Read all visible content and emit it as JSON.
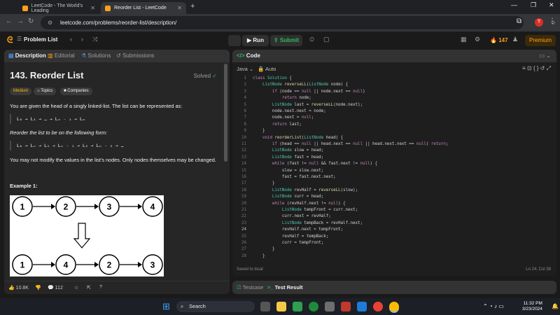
{
  "browser": {
    "tabs": [
      {
        "title": "LeetCode - The World's Leading"
      },
      {
        "title": "Reorder List - LeetCode"
      }
    ],
    "new_tab": "+",
    "url": "leetcode.com/problems/reorder-list/description/",
    "profile_initial": "T"
  },
  "topbar": {
    "problem_list": "Problem List",
    "run": "Run",
    "submit": "Submit",
    "streak": "147",
    "premium": "Premium"
  },
  "left": {
    "tabs": [
      "Description",
      "Editorial",
      "Solutions",
      "Submissions"
    ],
    "title": "143. Reorder List",
    "solved": "Solved",
    "difficulty": "Medium",
    "topics": "Topics",
    "companies": "Companies",
    "desc1": "You are given the head of a singly linked-list. The list can be represented as:",
    "formula1": "L₀ → L₁ → … → Lₙ ₋ ₁ → Lₙ",
    "desc2": "Reorder the list to be on the following form:",
    "formula2": "L₀ → Lₙ → L₁ → Lₙ ₋ ₁ → L₂ → Lₙ ₋ ₂ → …",
    "desc3": "You may not modify the values in the list's nodes. Only nodes themselves may be changed.",
    "example": "Example 1:",
    "diagram_top": [
      "1",
      "2",
      "3",
      "4"
    ],
    "diagram_bottom": [
      "1",
      "4",
      "2",
      "3"
    ],
    "likes": "10.8K",
    "comments": "112"
  },
  "code": {
    "header": "Code",
    "language": "Java",
    "mode": "Auto",
    "lines": [
      "class Solution {",
      "    ListNode reverseLL(ListNode node) {",
      "        if (node == null || node.next == null)",
      "            return node;",
      "        ListNode last = reverseLL(node.next);",
      "        node.next.next = node;",
      "        node.next = null;",
      "        return last;",
      "    }",
      "    void reorderList(ListNode head) {",
      "        if (head == null || head.next == null || head.next.next == null) return;",
      "        ListNode slow = head;",
      "        ListNode fast = head;",
      "        while (fast != null && fast.next != null) {",
      "            slow = slow.next;",
      "            fast = fast.next.next;",
      "        }",
      "        ListNode revHalf = reverseLL(slow);",
      "        ListNode curr = head;",
      "        while (revHalf.next != null) {",
      "            ListNode tempFront = curr.next;",
      "            curr.next = revHalf;",
      "            ListNode tempBack = revHalf.next;",
      "            revHalf.next = tempFront;",
      "            revHalf = tempBack;",
      "            curr = tempFront;",
      "        }",
      "    }"
    ],
    "saved": "Saved to local",
    "position": "Ln 24, Col 38"
  },
  "bottom": {
    "testcase": "Testcase",
    "result": "Test Result"
  },
  "taskbar": {
    "search": "Search",
    "time": "11:32 PM",
    "date": "3/23/2024"
  },
  "colors": {
    "accent": "#ffa116",
    "green": "#2cbb5d",
    "medium": "#ffb700"
  }
}
